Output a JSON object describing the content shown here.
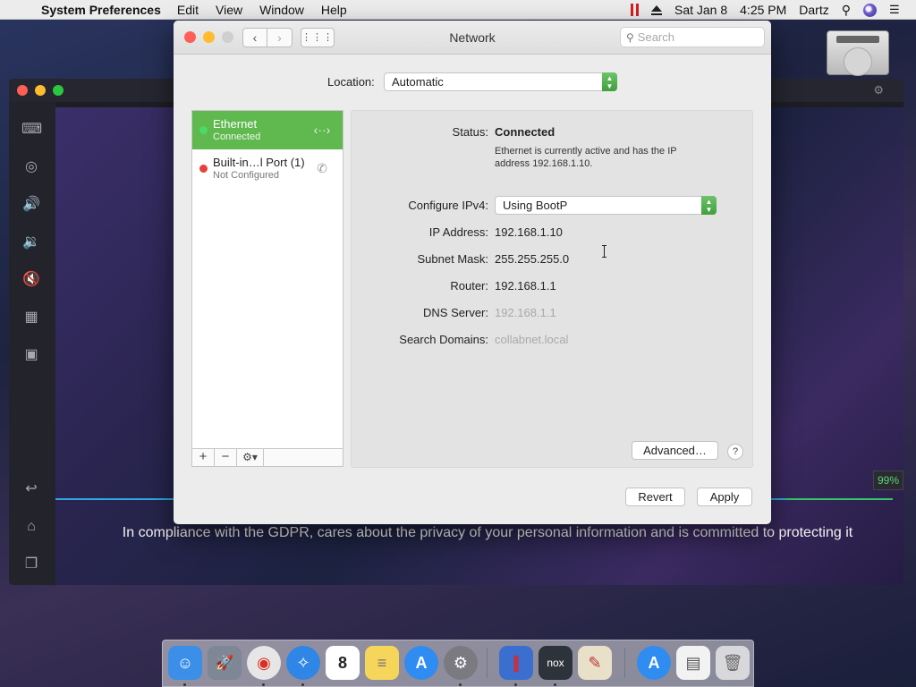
{
  "menubar": {
    "apple_icon": "",
    "app_name": "System Preferences",
    "menus": [
      "Edit",
      "View",
      "Window",
      "Help"
    ],
    "date": "Sat Jan 8",
    "time": "4:25 PM",
    "user": "Dartz"
  },
  "vm": {
    "progress_label": "99%",
    "caption": "In compliance with the GDPR, cares about the privacy of your personal information and is committed to protecting it"
  },
  "window": {
    "title": "Network",
    "search_placeholder": "Search"
  },
  "location": {
    "label": "Location:",
    "value": "Automatic"
  },
  "services": [
    {
      "name": "Ethernet",
      "status": "Connected",
      "dot_color": "#4cd964",
      "icon": "ethernet-arrows-icon",
      "glyph": "‹··›"
    },
    {
      "name": "Built-in…l Port (1)",
      "status": "Not Configured",
      "dot_color": "#e8403a",
      "icon": "phone-icon",
      "glyph": "✆"
    }
  ],
  "list_buttons": {
    "add": "+",
    "remove": "−",
    "action": "⚙▾"
  },
  "detail": {
    "status_label": "Status:",
    "status_value": "Connected",
    "status_desc": "Ethernet is currently active and has the IP address 192.168.1.10.",
    "configure_label": "Configure IPv4:",
    "configure_value": "Using BootP",
    "ip_label": "IP Address:",
    "ip_value": "192.168.1.10",
    "subnet_label": "Subnet Mask:",
    "subnet_value": "255.255.255.0",
    "router_label": "Router:",
    "router_value": "192.168.1.1",
    "dns_label": "DNS Server:",
    "dns_value": "192.168.1.1",
    "search_label": "Search Domains:",
    "search_value": "collabnet.local",
    "advanced_label": "Advanced…",
    "help_label": "?"
  },
  "footer": {
    "revert_label": "Revert",
    "apply_label": "Apply"
  },
  "dock": [
    {
      "name": "finder",
      "color": "#3b8fe8",
      "glyph": "☺"
    },
    {
      "name": "launchpad",
      "color": "#7e8796",
      "glyph": "🚀"
    },
    {
      "name": "chrome",
      "color": "#e6e6e6",
      "glyph": "◉"
    },
    {
      "name": "safari",
      "color": "#2f86e6",
      "glyph": "✧"
    },
    {
      "name": "calendar",
      "color": "#ffffff",
      "glyph": "8"
    },
    {
      "name": "notes",
      "color": "#f6d65a",
      "glyph": "≡"
    },
    {
      "name": "app-store",
      "color": "#2f8cf0",
      "glyph": "A"
    },
    {
      "name": "system-preferences",
      "color": "#7a7a80",
      "glyph": "⚙"
    },
    {
      "name": "parallels",
      "color": "#3a6fd0",
      "glyph": "∥"
    },
    {
      "name": "nox",
      "color": "#2c333a",
      "glyph": "nox"
    },
    {
      "name": "preview",
      "color": "#e8e0c8",
      "glyph": "✎"
    },
    {
      "name": "app-store-2",
      "color": "#2f8cf0",
      "glyph": "A"
    },
    {
      "name": "document",
      "color": "#f2f2f2",
      "glyph": "▤"
    },
    {
      "name": "trash",
      "color": "#d8d8dc",
      "glyph": "🗑"
    }
  ]
}
